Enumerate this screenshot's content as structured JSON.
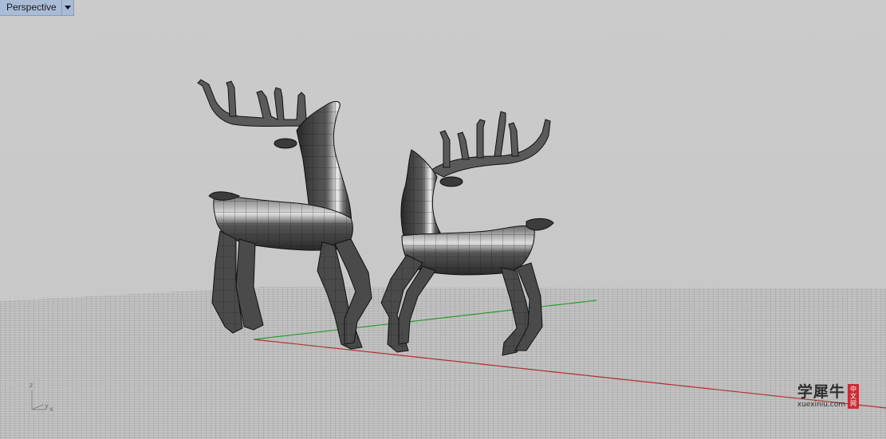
{
  "viewport": {
    "title": "Perspective",
    "dropdown_icon": "triangle-down-icon"
  },
  "axes_indicator": {
    "z_label": "z",
    "y_label": "y",
    "x_label": "x"
  },
  "scene": {
    "objects": [
      "deer-model-left",
      "deer-model-right"
    ],
    "grid": "construction-plane-grid",
    "x_axis_color": "#b03030",
    "y_axis_color": "#2e9a2e",
    "model_color": "#4a4a4a"
  },
  "watermark": {
    "main": "学犀牛",
    "sub": "xuexiniu.com",
    "seal_chars": [
      "中",
      "文",
      "网"
    ]
  }
}
